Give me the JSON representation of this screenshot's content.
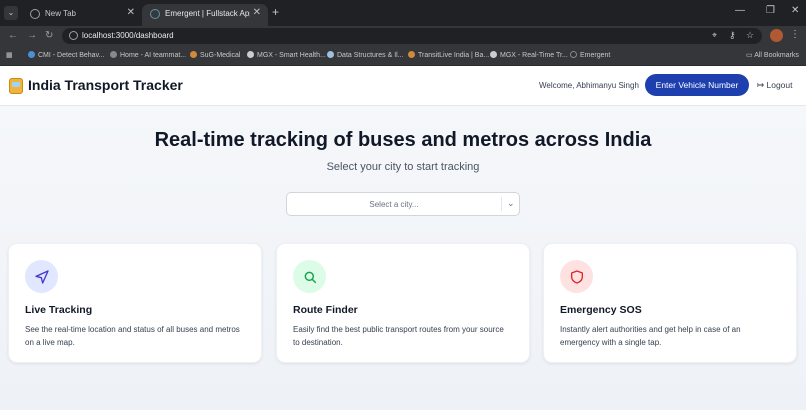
{
  "browser": {
    "tabs": [
      {
        "label": "New Tab"
      },
      {
        "label": "Emergent | Fullstack App"
      }
    ],
    "url": "localhost:3000/dashboard",
    "bookmarks": [
      {
        "label": "CMI - Detect Behav...",
        "color": "#4a90d9"
      },
      {
        "label": "Home - AI teammat...",
        "color": "#888888"
      },
      {
        "label": "SuG-Medical",
        "color": "#d08a3a"
      },
      {
        "label": "MGX - Smart Health...",
        "color": "#cccccc"
      },
      {
        "label": "Data Structures & Il...",
        "color": "#a0c0e0"
      },
      {
        "label": "TransitLive India | Ba...",
        "color": "#d08a3a"
      },
      {
        "label": "MGX - Real-Time Tr...",
        "color": "#cccccc"
      },
      {
        "label": "Emergent",
        "color": "#333333"
      }
    ],
    "all_bookmarks": "All Bookmarks"
  },
  "header": {
    "brand": "India Transport Tracker",
    "welcome": "Welcome, Abhimanyu Singh",
    "vehicle_button": "Enter Vehicle Number",
    "logout": "Logout"
  },
  "hero": {
    "title": "Real-time tracking of buses and metros across India",
    "subtitle": "Select your city to start tracking",
    "city_placeholder": "Select a city..."
  },
  "cards": [
    {
      "title": "Live Tracking",
      "description": "See the real-time location and status of all buses and metros on a live map.",
      "icon": "navigation-arrow-icon",
      "icon_bg": "#e0e7ff",
      "icon_color": "#4338ca"
    },
    {
      "title": "Route Finder",
      "description": "Easily find the best public transport routes from your source to destination.",
      "icon": "search-icon",
      "icon_bg": "#dcfce7",
      "icon_color": "#16a34a"
    },
    {
      "title": "Emergency SOS",
      "description": "Instantly alert authorities and get help in case of an emergency with a single tap.",
      "icon": "shield-icon",
      "icon_bg": "#fee2e2",
      "icon_color": "#dc2626"
    }
  ],
  "colors": {
    "primary_button": "#1e40af",
    "page_bg": "#f3f5f9"
  }
}
